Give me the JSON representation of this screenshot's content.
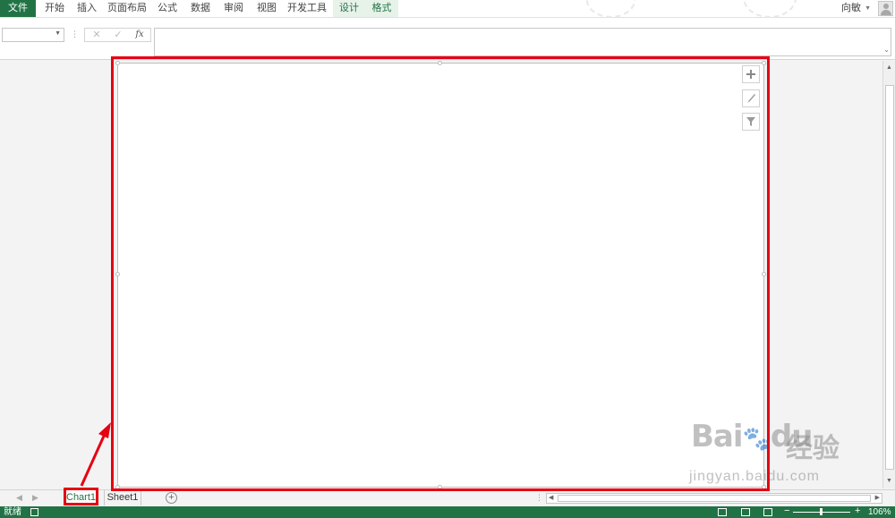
{
  "ribbon": {
    "tabs": [
      {
        "label": "文件",
        "kind": "file"
      },
      {
        "label": "开始",
        "kind": "normal"
      },
      {
        "label": "插入",
        "kind": "normal"
      },
      {
        "label": "页面布局",
        "kind": "normal"
      },
      {
        "label": "公式",
        "kind": "normal"
      },
      {
        "label": "数据",
        "kind": "normal"
      },
      {
        "label": "审阅",
        "kind": "normal"
      },
      {
        "label": "视图",
        "kind": "normal"
      },
      {
        "label": "开发工具",
        "kind": "normal"
      },
      {
        "label": "设计",
        "kind": "context"
      },
      {
        "label": "格式",
        "kind": "context"
      }
    ],
    "user_name": "向敏"
  },
  "formula_bar": {
    "name_box_value": "",
    "cancel_symbol": "✕",
    "enter_symbol": "✓",
    "function_symbol": "fx",
    "formula_value": ""
  },
  "chart_tools": [
    "chart-elements-icon",
    "chart-styles-icon",
    "chart-filters-icon"
  ],
  "sheets": {
    "tabs": [
      "Chart1",
      "Sheet1"
    ],
    "active": "Chart1"
  },
  "status_bar": {
    "ready_text": "就绪",
    "zoom_level": "106%"
  },
  "watermark": {
    "logo": "Bai",
    "logo_mark": "du",
    "brand_cn": "经验",
    "url": "jingyan.baidu.com"
  },
  "colors": {
    "accent": "#217346",
    "highlight": "#e60012"
  }
}
